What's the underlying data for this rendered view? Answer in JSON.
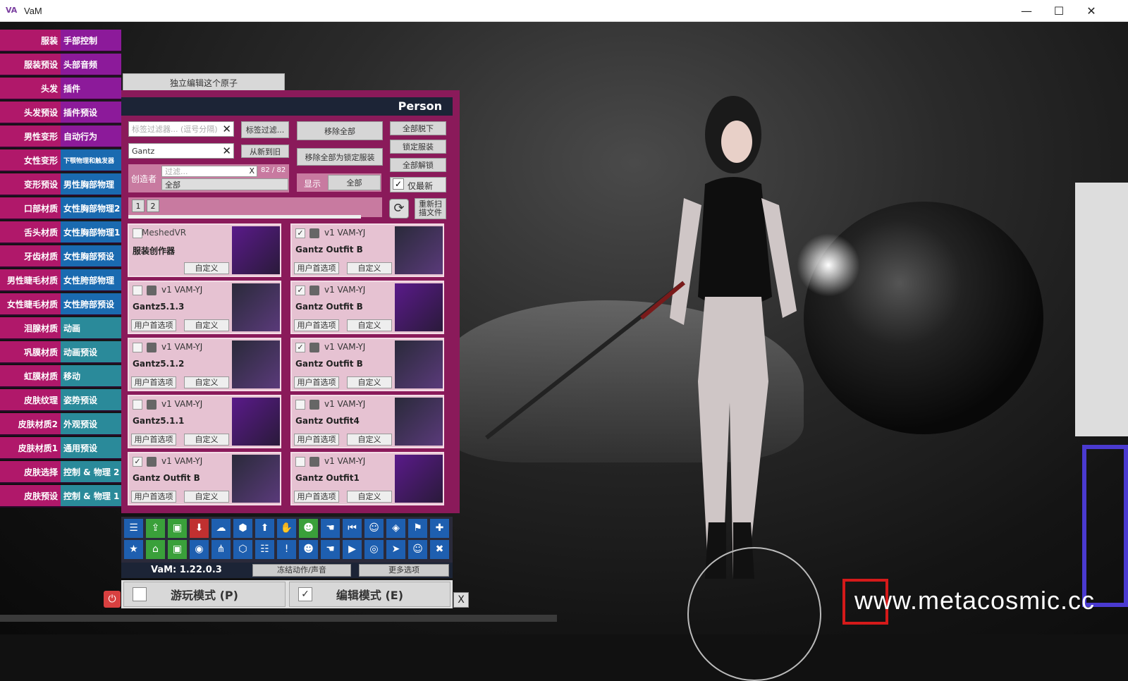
{
  "window": {
    "title": "VaM",
    "min": "—",
    "max": "☐",
    "close": "✕"
  },
  "left_menu": [
    [
      "服装",
      "手部控制"
    ],
    [
      "服装预设",
      "头部音频"
    ],
    [
      "头发",
      "插件"
    ],
    [
      "头发预设",
      "插件预设"
    ],
    [
      "男性变形",
      "自动行为"
    ],
    [
      "女性变形",
      "下颚物理和触发器"
    ],
    [
      "变形预设",
      "男性胸部物理"
    ],
    [
      "口部材质",
      "女性胸部物理2"
    ],
    [
      "舌头材质",
      "女性胸部物理1"
    ],
    [
      "牙齿材质",
      "女性胸部预设"
    ],
    [
      "男性睫毛材质",
      "女性胯部物理"
    ],
    [
      "女性睫毛材质",
      "女性胯部预设"
    ],
    [
      "泪腺材质",
      "动画"
    ],
    [
      "巩膜材质",
      "动画预设"
    ],
    [
      "虹膜材质",
      "移动"
    ],
    [
      "皮肤纹理",
      "姿势预设"
    ],
    [
      "皮肤材质2",
      "外观预设"
    ],
    [
      "皮肤材质1",
      "通用预设"
    ],
    [
      "皮肤选择",
      "控制 & 物理 2"
    ],
    [
      "皮肤预设",
      "控制 & 物理 1"
    ]
  ],
  "isolate_button": "独立编辑这个原子",
  "panel": {
    "title": "Person",
    "tag_filter_placeholder": "标签过滤器... (逗号分隔)",
    "tag_filter_btn": "标签过滤...",
    "search_value": "Gantz",
    "sort_btn": "从新到旧",
    "remove_all": "移除全部",
    "remove_all_locked": "移除全部为锁定服装",
    "undress_all": "全部脱下",
    "lock_clothing": "锁定服装",
    "unlock_all": "全部解锁",
    "creator_label": "创造者",
    "creator_filter_placeholder": "过滤...",
    "creator_count": "82 / 82",
    "creator_value": "全部",
    "show_label": "显示",
    "show_value": "全部",
    "only_latest": "仅最新",
    "rescan": "重新扫描文件",
    "pages": [
      "1",
      "2"
    ],
    "items": [
      {
        "checked": false,
        "creator": "MeshedVR",
        "ver": "",
        "name": "服装创作器",
        "b1": "",
        "b2": "自定义"
      },
      {
        "checked": true,
        "creator": "",
        "ver": "v1  VAM-YJ",
        "name": "Gantz Outfit B",
        "b1": "用户首选项",
        "b2": "自定义"
      },
      {
        "checked": false,
        "creator": "",
        "ver": "v1  VAM-YJ",
        "name": "Gantz5.1.3",
        "b1": "用户首选项",
        "b2": "自定义"
      },
      {
        "checked": true,
        "creator": "",
        "ver": "v1  VAM-YJ",
        "name": "Gantz Outfit B",
        "b1": "用户首选项",
        "b2": "自定义"
      },
      {
        "checked": false,
        "creator": "",
        "ver": "v1  VAM-YJ",
        "name": "Gantz5.1.2",
        "b1": "用户首选项",
        "b2": "自定义"
      },
      {
        "checked": true,
        "creator": "",
        "ver": "v1  VAM-YJ",
        "name": "Gantz Outfit B",
        "b1": "用户首选项",
        "b2": "自定义"
      },
      {
        "checked": false,
        "creator": "",
        "ver": "v1  VAM-YJ",
        "name": "Gantz5.1.1",
        "b1": "用户首选项",
        "b2": "自定义"
      },
      {
        "checked": false,
        "creator": "",
        "ver": "v1  VAM-YJ",
        "name": "Gantz Outfit4",
        "b1": "用户首选项",
        "b2": "自定义"
      },
      {
        "checked": true,
        "creator": "",
        "ver": "v1  VAM-YJ",
        "name": "Gantz Outfit B",
        "b1": "用户首选项",
        "b2": "自定义"
      },
      {
        "checked": false,
        "creator": "",
        "ver": "v1  VAM-YJ",
        "name": "Gantz Outfit1",
        "b1": "用户首选项",
        "b2": "自定义"
      }
    ]
  },
  "bottom": {
    "version": "VaM: 1.22.0.3",
    "freeze": "冻结动作/声音",
    "more": "更多选项",
    "play_mode": "游玩模式 (P)",
    "edit_mode": "编辑模式 (E)",
    "close": "X"
  },
  "watermark": "www.metacosmic.cc"
}
